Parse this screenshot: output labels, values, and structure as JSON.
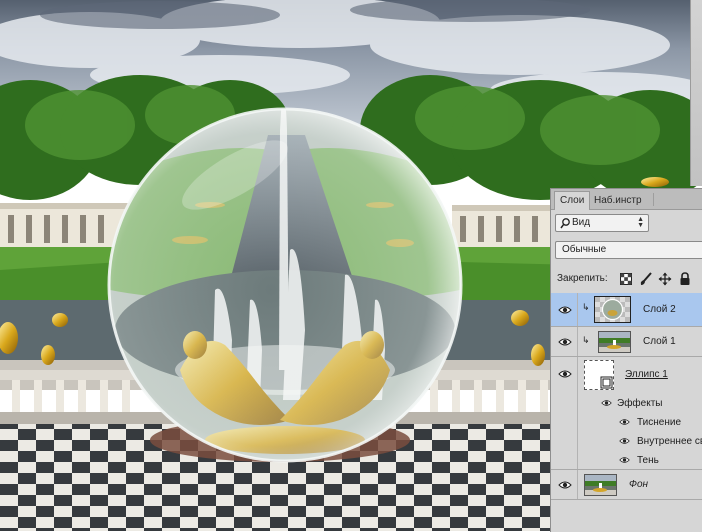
{
  "panel": {
    "tabs": [
      {
        "label": "Слои",
        "active": true
      },
      {
        "label": "Наб.инстр",
        "active": false
      }
    ],
    "filter": {
      "icon": "search-icon",
      "value": "Вид"
    },
    "blend_mode": {
      "value": "Обычные"
    },
    "lock_label": "Закрепить:",
    "lock_icons": [
      "lock-transparent-pixels-icon",
      "lock-image-pixels-icon",
      "lock-position-icon",
      "lock-all-icon"
    ],
    "layers": [
      {
        "name": "Слой 2",
        "visible": true,
        "selected": true,
        "clipped": true,
        "thumbnail": "glass-sphere-thumbnail"
      },
      {
        "name": "Слой 1",
        "visible": true,
        "selected": false,
        "clipped": true,
        "thumbnail": "photo-thumbnail"
      },
      {
        "name": "Эллипс 1",
        "visible": true,
        "selected": false,
        "clipped": false,
        "thumbnail": "shape-thumbnail",
        "effects_label": "Эффекты",
        "effects": [
          "Тиснение",
          "Внутреннее свечение",
          "Тень"
        ]
      },
      {
        "name": "Фон",
        "visible": true,
        "selected": false,
        "clipped": false,
        "thumbnail": "photo-thumbnail"
      }
    ]
  },
  "colors": {
    "panel_bg": "#d6d6d6",
    "selected_layer": "#a9c7ee",
    "tab_bar": "#bcbcbc"
  }
}
